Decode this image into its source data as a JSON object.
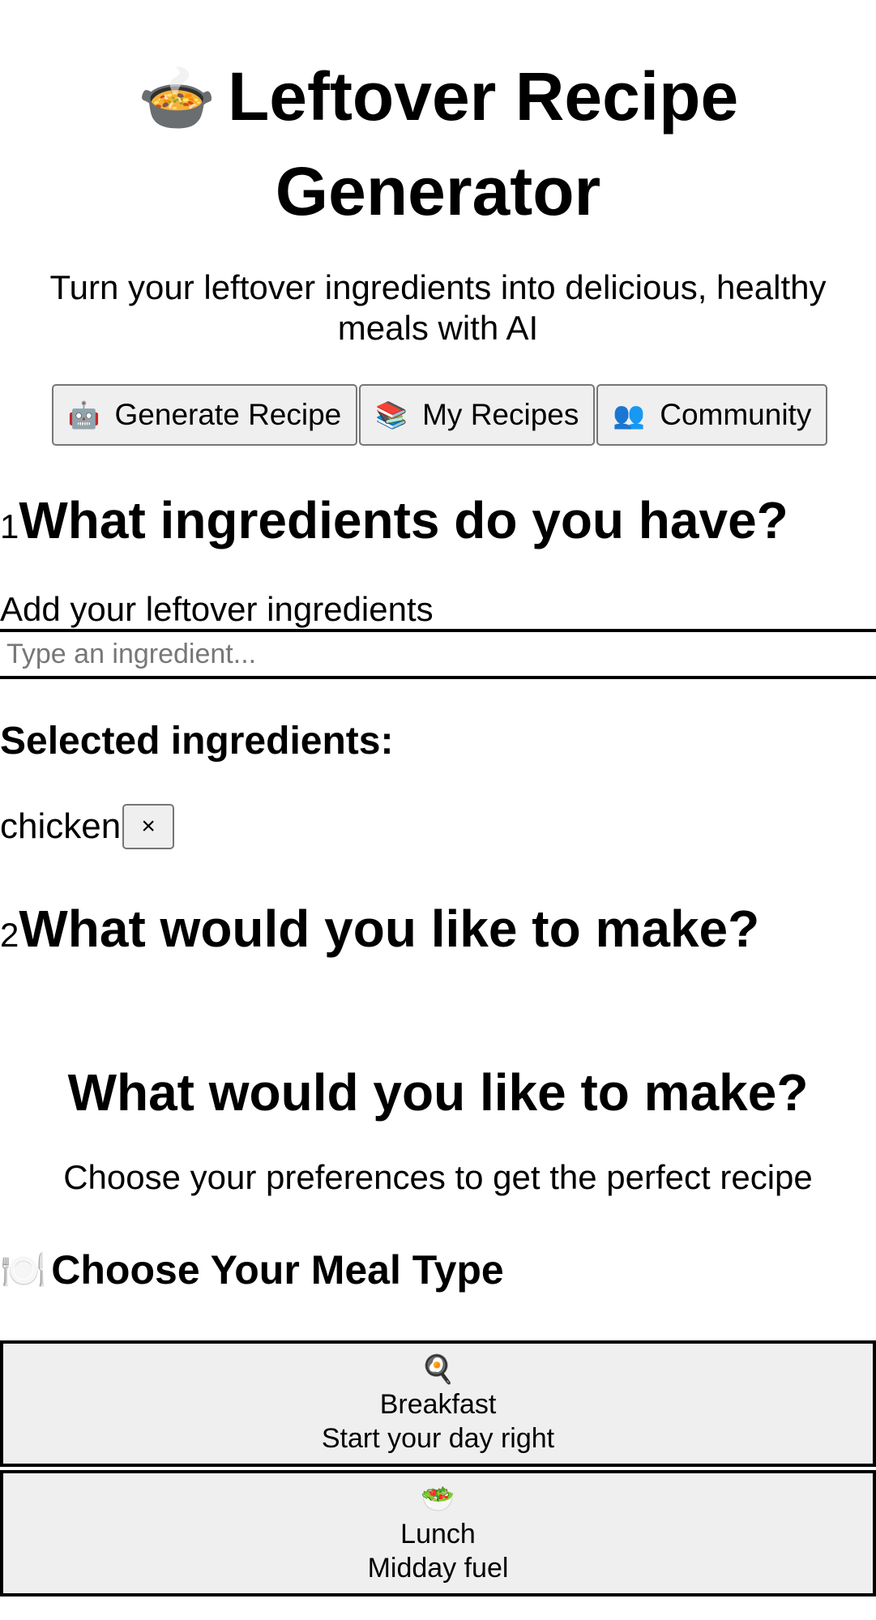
{
  "header": {
    "title_emoji": "🍲",
    "title": "Leftover Recipe Generator",
    "subtitle": "Turn your leftover ingredients into delicious, healthy meals with AI"
  },
  "nav": [
    {
      "icon": "🤖",
      "icon_name": "robot-icon",
      "label": "Generate Recipe"
    },
    {
      "icon": "📚",
      "icon_name": "books-icon",
      "label": "My Recipes"
    },
    {
      "icon": "👥",
      "icon_name": "people-icon",
      "label": "Community"
    }
  ],
  "step1": {
    "number": "1",
    "heading": "What ingredients do you have?",
    "input_label": "Add your leftover ingredients",
    "input_value": "",
    "input_placeholder": "Type an ingredient...",
    "selected_heading": "Selected ingredients:",
    "selected": [
      {
        "name": "chicken",
        "remove_label": "×"
      }
    ]
  },
  "step2": {
    "number": "2",
    "heading": "What would you like to make?",
    "section_title": "What would you like to make?",
    "section_subtitle": "Choose your preferences to get the perfect recipe",
    "meal_heading_icon": "🍽️",
    "meal_heading": "Choose Your Meal Type",
    "meal_types": [
      {
        "icon": "🍳",
        "icon_name": "frying-pan-icon",
        "name": "Breakfast",
        "desc": "Start your day right"
      },
      {
        "icon": "🥗",
        "icon_name": "salad-icon",
        "name": "Lunch",
        "desc": "Midday fuel"
      }
    ]
  }
}
